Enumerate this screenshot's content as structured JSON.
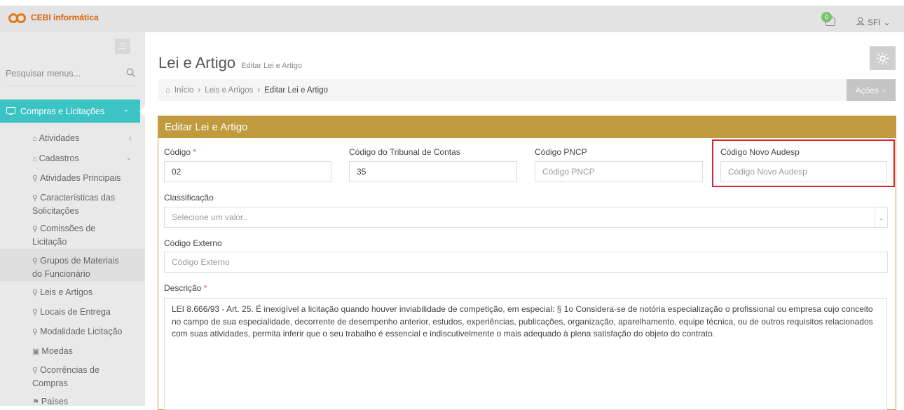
{
  "topbar": {
    "brand": "CEBI informática",
    "notification_count": "0",
    "user_label": "SFI",
    "user_chevron": "⌄"
  },
  "sidebar": {
    "search_placeholder": "Pesquisar menus...",
    "active_group": "Compras e Licitações",
    "items": [
      {
        "label": "Atividades",
        "icon": "home-icon"
      },
      {
        "label": "Cadastros",
        "icon": "home-icon"
      }
    ],
    "sub_items": [
      "Atividades Principais",
      "Características das Solicitações",
      "Comissões de Licitação",
      "Grupos de Materiais do Funcionário",
      "Leis e Artigos",
      "Locais de Entrega",
      "Modalidade Licitação",
      "Moedas",
      "Ocorrências de Compras",
      "Países"
    ]
  },
  "page": {
    "title": "Lei e Artigo",
    "subtitle": "Editar Lei e Artigo",
    "breadcrumb": [
      "Início",
      "Leis e Artigos",
      "Editar Lei e Artigo"
    ],
    "actions_label": "Ações"
  },
  "form": {
    "panel_title": "Editar Lei e Artigo",
    "codigo_label": "Código",
    "codigo_value": "02",
    "tribunal_label": "Código do Tribunal de Contas",
    "tribunal_value": "35",
    "pncp_label": "Código PNCP",
    "pncp_placeholder": "Código PNCP",
    "audesp_label": "Código Novo Audesp",
    "audesp_placeholder": "Código Novo Audesp",
    "classificacao_label": "Classificação",
    "classificacao_placeholder": "Selecione um valor..",
    "externo_label": "Código Externo",
    "externo_placeholder": "Código Externo",
    "descricao_label": "Descrição",
    "required_mark": "*",
    "descricao_value": "LEI 8.666/93 - Art. 25.  É inexigível a licitação quando houver inviabilidade de competição, em especial: § 1o  Considera-se de notória especialização o profissional ou empresa cujo conceito no campo de sua especialidade, decorrente de desempenho anterior, estudos, experiências, publicações, organização, aparelhamento, equipe técnica, ou de outros requisitos relacionados com suas atividades, permita inferir que o seu trabalho é essencial e indiscutivelmente o mais adequado à plena satisfação do objeto do contrato."
  },
  "colors": {
    "accent": "#3cc3c4",
    "panel_header": "#c19a3e",
    "highlight": "#d9262c",
    "brand": "#d7640f"
  }
}
